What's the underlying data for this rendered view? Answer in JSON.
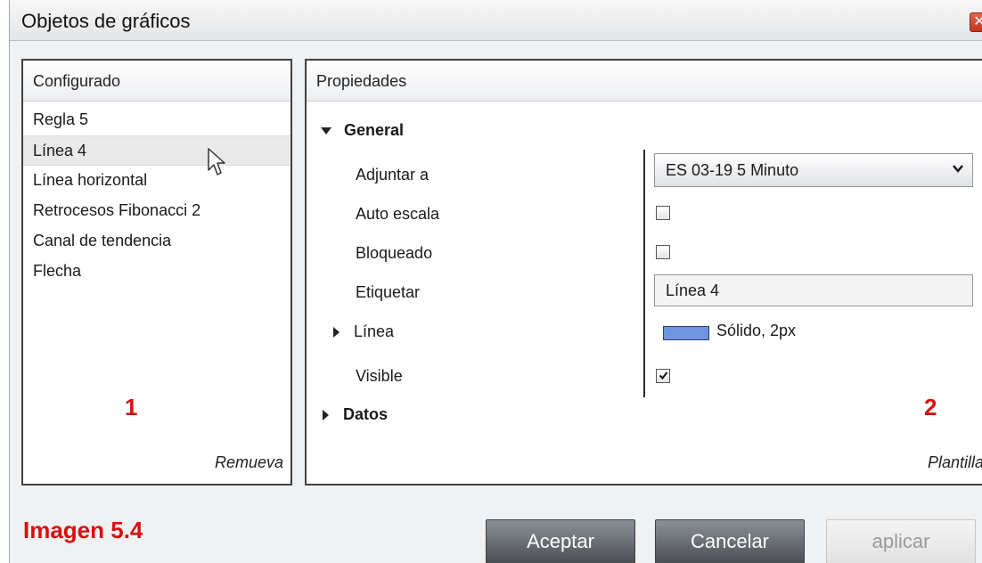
{
  "window": {
    "title": "Objetos de gráficos",
    "close_icon": "close-icon",
    "accent_close": "#c9381e"
  },
  "configured": {
    "header": "Configurado",
    "items": [
      "Regla 5",
      "Línea 4",
      "Línea horizontal",
      "Retrocesos Fibonacci 2",
      "Canal de tendencia",
      "Flecha"
    ],
    "selected_index": 1,
    "marker": "1",
    "remove_link": "Remueva"
  },
  "properties": {
    "header": "Propiedades",
    "general_section": "General",
    "attach_label": "Adjuntar a",
    "attach_value": "ES 03-19 5 Minuto",
    "autoscale_label": "Auto escala",
    "autoscale_checked": false,
    "locked_label": "Bloqueado",
    "locked_checked": false,
    "tag_label": "Etiquetar",
    "tag_value": "Línea 4",
    "line_label": "Línea",
    "line_value": "Sólido, 2px",
    "line_color": "#6f95e0",
    "visible_label": "Visible",
    "visible_checked": true,
    "data_section": "Datos",
    "marker": "2",
    "template_link": "Plantilla"
  },
  "caption": "Imagen 5.4",
  "buttons": {
    "accept": "Aceptar",
    "cancel": "Cancelar",
    "apply": "aplicar"
  },
  "colors": {
    "annotation_red": "#d90f0f"
  }
}
